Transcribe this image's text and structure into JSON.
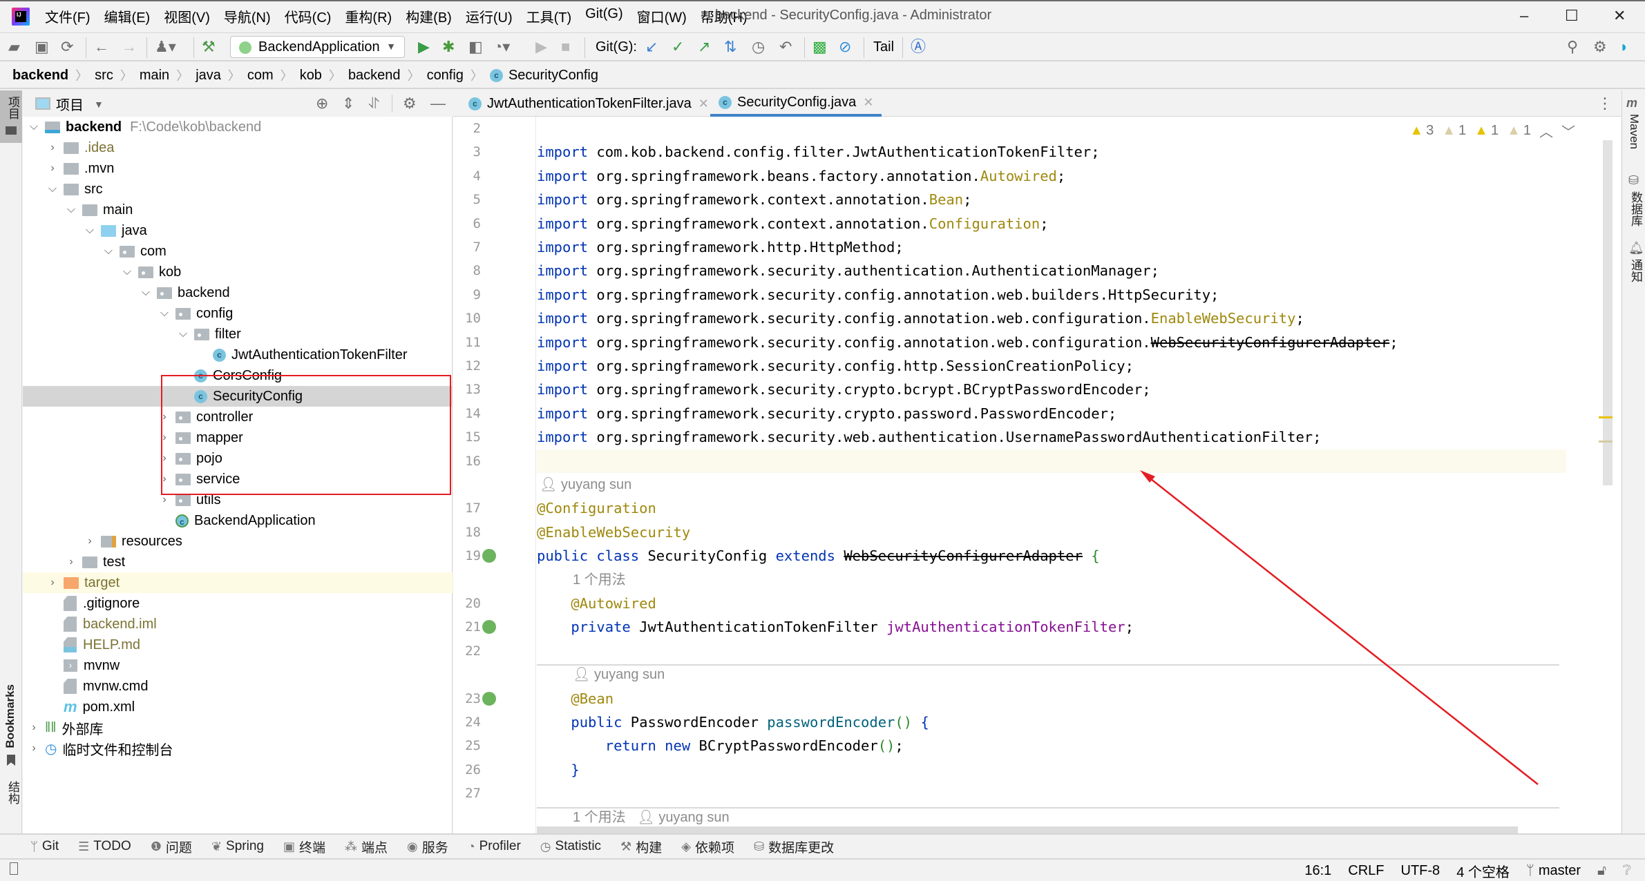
{
  "window": {
    "title": "backend - SecurityConfig.java - Administrator",
    "controls": {
      "minimize": "–",
      "maximize": "☐",
      "close": "✕"
    }
  },
  "menu": [
    "文件(F)",
    "编辑(E)",
    "视图(V)",
    "导航(N)",
    "代码(C)",
    "重构(R)",
    "构建(B)",
    "运行(U)",
    "工具(T)",
    "Git(G)",
    "窗口(W)",
    "帮助(H)"
  ],
  "toolbar": {
    "run_config": "BackendApplication",
    "git_label": "Git(G):",
    "tail_label": "Tail",
    "icons": [
      "open-icon",
      "save-icon",
      "sync-icon",
      "back-icon",
      "forward-icon",
      "user-icon",
      "build-hammer-icon",
      "run-icon",
      "debug-icon",
      "coverage-icon",
      "profile-icon",
      "run-disabled-icon",
      "stop-icon",
      "git-update-icon",
      "git-commit-icon",
      "git-push-icon",
      "git-fetch-icon",
      "history-icon",
      "rollback-icon",
      "monitor-icon",
      "ban-icon",
      "translate-icon",
      "search-icon",
      "settings-icon",
      "plugin-icon"
    ]
  },
  "breadcrumb": [
    "backend",
    "src",
    "main",
    "java",
    "com",
    "kob",
    "backend",
    "config",
    "SecurityConfig"
  ],
  "left_strip": {
    "project": "项目",
    "bookmarks": "Bookmarks",
    "structure": "结构"
  },
  "right_strip": {
    "maven": "Maven",
    "database": "数据库",
    "notifications": "通知"
  },
  "project_panel": {
    "title": "项目",
    "tree": [
      {
        "label": "backend",
        "path": "F:\\Code\\kob\\backend",
        "depth": 0,
        "arrow": "down",
        "icon": "module",
        "bold": true
      },
      {
        "label": ".idea",
        "depth": 1,
        "arrow": "right",
        "icon": "folder",
        "olive": true
      },
      {
        "label": ".mvn",
        "depth": 1,
        "arrow": "right",
        "icon": "folder"
      },
      {
        "label": "src",
        "depth": 1,
        "arrow": "down",
        "icon": "folder"
      },
      {
        "label": "main",
        "depth": 2,
        "arrow": "down",
        "icon": "folder"
      },
      {
        "label": "java",
        "depth": 3,
        "arrow": "down",
        "icon": "src"
      },
      {
        "label": "com",
        "depth": 4,
        "arrow": "down",
        "icon": "pkg"
      },
      {
        "label": "kob",
        "depth": 5,
        "arrow": "down",
        "icon": "pkg"
      },
      {
        "label": "backend",
        "depth": 6,
        "arrow": "down",
        "icon": "pkg"
      },
      {
        "label": "config",
        "depth": 7,
        "arrow": "down",
        "icon": "pkg"
      },
      {
        "label": "filter",
        "depth": 8,
        "arrow": "down",
        "icon": "pkg"
      },
      {
        "label": "JwtAuthenticationTokenFilter",
        "depth": 9,
        "arrow": "",
        "icon": "class"
      },
      {
        "label": "CorsConfig",
        "depth": 8,
        "arrow": "",
        "icon": "class"
      },
      {
        "label": "SecurityConfig",
        "depth": 8,
        "arrow": "",
        "icon": "class",
        "selected": true
      },
      {
        "label": "controller",
        "depth": 7,
        "arrow": "right",
        "icon": "pkg"
      },
      {
        "label": "mapper",
        "depth": 7,
        "arrow": "right",
        "icon": "pkg"
      },
      {
        "label": "pojo",
        "depth": 7,
        "arrow": "right",
        "icon": "pkg"
      },
      {
        "label": "service",
        "depth": 7,
        "arrow": "right",
        "icon": "pkg"
      },
      {
        "label": "utils",
        "depth": 7,
        "arrow": "right",
        "icon": "pkg"
      },
      {
        "label": "BackendApplication",
        "depth": 7,
        "arrow": "",
        "icon": "springclass"
      },
      {
        "label": "resources",
        "depth": 3,
        "arrow": "right",
        "icon": "res"
      },
      {
        "label": "test",
        "depth": 2,
        "arrow": "right",
        "icon": "folder"
      },
      {
        "label": "target",
        "depth": 1,
        "arrow": "right",
        "icon": "target",
        "olive": true,
        "highlight": true
      },
      {
        "label": ".gitignore",
        "depth": 1,
        "arrow": "",
        "icon": "file"
      },
      {
        "label": "backend.iml",
        "depth": 1,
        "arrow": "",
        "icon": "file",
        "olive": true
      },
      {
        "label": "HELP.md",
        "depth": 1,
        "arrow": "",
        "icon": "md",
        "olive": true
      },
      {
        "label": "mvnw",
        "depth": 1,
        "arrow": "",
        "icon": "shell"
      },
      {
        "label": "mvnw.cmd",
        "depth": 1,
        "arrow": "",
        "icon": "file"
      },
      {
        "label": "pom.xml",
        "depth": 1,
        "arrow": "",
        "icon": "maven"
      },
      {
        "label": "外部库",
        "depth": 0,
        "arrow": "right",
        "icon": "lib"
      },
      {
        "label": "临时文件和控制台",
        "depth": 0,
        "arrow": "right",
        "icon": "scratch"
      }
    ]
  },
  "editor": {
    "tabs": [
      {
        "label": "JwtAuthenticationTokenFilter.java",
        "active": false
      },
      {
        "label": "SecurityConfig.java",
        "active": true
      }
    ],
    "inspections": {
      "warnings": "3",
      "weak_warnings_a": "1",
      "warnings_b": "1",
      "weak_warnings_b": "1"
    },
    "author_hint": "yuyang sun",
    "usage_hint": "1 个用法",
    "lines": [
      {
        "n": "2",
        "html": ""
      },
      {
        "n": "3",
        "html": "<span class='kw'>import</span> com.kob.backend.config.filter.JwtAuthenticationTokenFilter;"
      },
      {
        "n": "4",
        "html": "<span class='kw'>import</span> org.springframework.beans.factory.annotation.<span class='ann'>Autowired</span>;"
      },
      {
        "n": "5",
        "html": "<span class='kw'>import</span> org.springframework.context.annotation.<span class='ann'>Bean</span>;"
      },
      {
        "n": "6",
        "html": "<span class='kw'>import</span> org.springframework.context.annotation.<span class='ann'>Configuration</span>;"
      },
      {
        "n": "7",
        "html": "<span class='kw'>import</span> org.springframework.http.HttpMethod;"
      },
      {
        "n": "8",
        "html": "<span class='kw'>import</span> org.springframework.security.authentication.AuthenticationManager;"
      },
      {
        "n": "9",
        "html": "<span class='kw'>import</span> org.springframework.security.config.annotation.web.builders.HttpSecurity;"
      },
      {
        "n": "10",
        "html": "<span class='kw'>import</span> org.springframework.security.config.annotation.web.configuration.<span class='ann'>EnableWebSecurity</span>;"
      },
      {
        "n": "11",
        "html": "<span class='kw'>import</span> org.springframework.security.config.annotation.web.configuration.<span class='strike'>WebSecurityConfigurerAdapter</span>;"
      },
      {
        "n": "12",
        "html": "<span class='kw'>import</span> org.springframework.security.config.http.SessionCreationPolicy;"
      },
      {
        "n": "13",
        "html": "<span class='kw'>import</span> org.springframework.security.crypto.bcrypt.BCryptPasswordEncoder;"
      },
      {
        "n": "14",
        "html": "<span class='kw'>import</span> org.springframework.security.crypto.password.PasswordEncoder;"
      },
      {
        "n": "15",
        "html": "<span class='kw'>import</span> org.springframework.security.web.authentication.UsernamePasswordAuthenticationFilter;"
      },
      {
        "n": "16",
        "html": "",
        "caret": true
      },
      {
        "n": "",
        "hint": "author"
      },
      {
        "n": "17",
        "html": "<span class='ann'>@Configuration</span>"
      },
      {
        "n": "18",
        "html": "<span class='ann'>@EnableWebSecurity</span>"
      },
      {
        "n": "19",
        "html": "<span class='kw'>public class</span> SecurityConfig <span class='kw'>extends</span> <span class='strike'>WebSecurityConfigurerAdapter</span> <span class='paren'>{</span>",
        "gutter": "spring"
      },
      {
        "n": "",
        "hint": "usage",
        "indent": 1
      },
      {
        "n": "20",
        "html": "    <span class='ann'>@Autowired</span>"
      },
      {
        "n": "21",
        "html": "    <span class='kw'>private</span> JwtAuthenticationTokenFilter <span class='fld'>jwtAuthenticationTokenFilter</span>;",
        "gutter": "spring"
      },
      {
        "n": "22",
        "html": ""
      },
      {
        "n": "",
        "hint": "author",
        "indent": 1,
        "divider": true
      },
      {
        "n": "23",
        "html": "    <span class='ann'>@Bean</span>",
        "gutter": "spring"
      },
      {
        "n": "24",
        "html": "    <span class='kw'>public</span> PasswordEncoder <span class='meth'>passwordEncoder</span><span class='paren'>()</span> <span class='kw'>{</span>"
      },
      {
        "n": "25",
        "html": "        <span class='kw'>return new</span> BCryptPasswordEncoder<span class='paren'>()</span>;"
      },
      {
        "n": "26",
        "html": "    <span class='kw'>}</span>"
      },
      {
        "n": "27",
        "html": ""
      },
      {
        "n": "",
        "hint": "usage-author",
        "indent": 1,
        "divider": true
      }
    ]
  },
  "bottom_tools": [
    {
      "icon": "ᛘ",
      "label": "Git"
    },
    {
      "icon": "☰",
      "label": "TODO"
    },
    {
      "icon": "❶",
      "label": "问题"
    },
    {
      "icon": "❦",
      "label": "Spring"
    },
    {
      "icon": "▣",
      "label": "终端"
    },
    {
      "icon": "⁂",
      "label": "端点"
    },
    {
      "icon": "◉",
      "label": "服务"
    },
    {
      "icon": "◔",
      "label": "Profiler"
    },
    {
      "icon": "◷",
      "label": "Statistic"
    },
    {
      "icon": "⚒",
      "label": "构建"
    },
    {
      "icon": "◈",
      "label": "依赖项"
    },
    {
      "icon": "⛁",
      "label": "数据库更改"
    }
  ],
  "status": {
    "position": "16:1",
    "line_sep": "CRLF",
    "encoding": "UTF-8",
    "indent": "4 个空格",
    "branch": "master"
  },
  "colors": {
    "annotation_box": "#e41d22",
    "accent": "#4083c9",
    "warning": "#e8c200"
  }
}
